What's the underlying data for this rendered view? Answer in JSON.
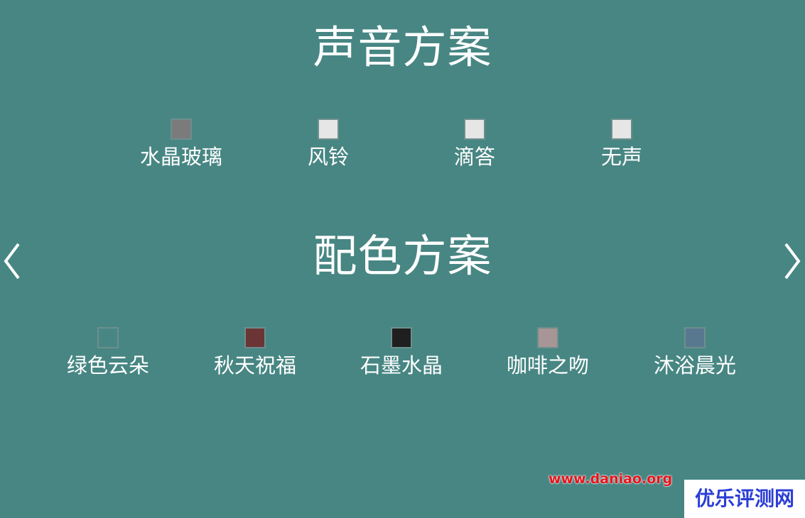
{
  "sound_scheme": {
    "title": "声音方案",
    "options": [
      {
        "label": "水晶玻璃",
        "color": "#7b7b7b"
      },
      {
        "label": "风铃",
        "color": "#e6e6e6"
      },
      {
        "label": "滴答",
        "color": "#e6e6e6"
      },
      {
        "label": "无声",
        "color": "#e6e6e6"
      }
    ]
  },
  "color_scheme": {
    "title": "配色方案",
    "options": [
      {
        "label": "绿色云朵",
        "color": "#478683"
      },
      {
        "label": "秋天祝福",
        "color": "#6b3536"
      },
      {
        "label": "石墨水晶",
        "color": "#1f1f1f"
      },
      {
        "label": "咖啡之吻",
        "color": "#a89595"
      },
      {
        "label": "沐浴晨光",
        "color": "#57788f"
      }
    ]
  },
  "navigation": {
    "prev_icon": "chevron-left-icon",
    "next_icon": "chevron-right-icon"
  },
  "watermark": {
    "url": "www.daniao.org",
    "site_name": "优乐评测网"
  },
  "colors": {
    "background": "#478683",
    "text": "#ffffff",
    "watermark_url": "#e8151c",
    "watermark_site": "#2b3ed6"
  }
}
